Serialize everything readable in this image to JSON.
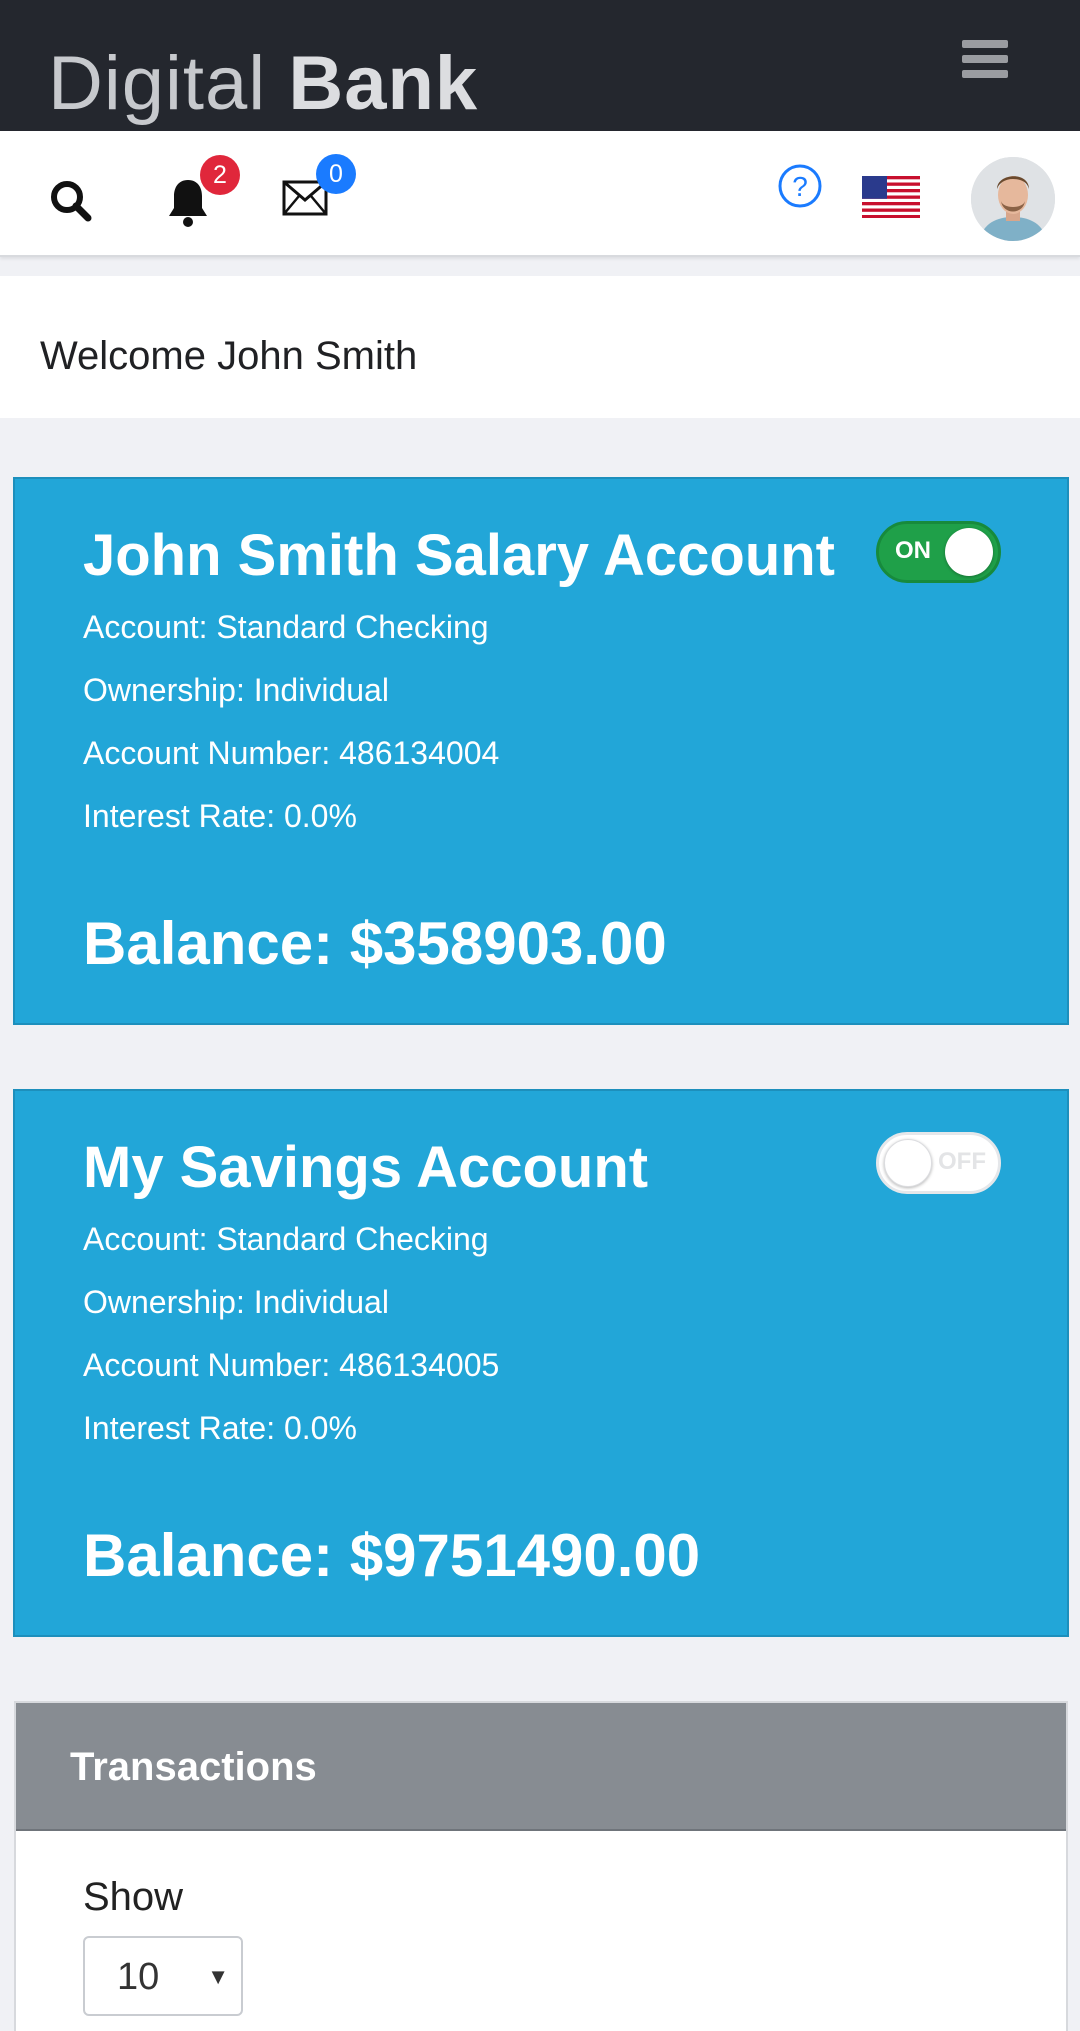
{
  "header": {
    "brand_light": "Digital",
    "brand_bold": "Bank"
  },
  "toolbar": {
    "notifications_count": "2",
    "messages_count": "0"
  },
  "welcome": {
    "text": "Welcome John Smith"
  },
  "accounts": [
    {
      "name": "John Smith Salary Account",
      "toggle_label": "ON",
      "toggle_state": "on",
      "account_type": "Account: Standard Checking",
      "ownership": "Ownership: Individual",
      "account_number": "Account Number: 486134004",
      "interest_rate": "Interest Rate: 0.0%",
      "balance": "Balance: $358903.00"
    },
    {
      "name": "My Savings Account",
      "toggle_label": "OFF",
      "toggle_state": "off",
      "account_type": "Account: Standard Checking",
      "ownership": "Ownership: Individual",
      "account_number": "Account Number: 486134005",
      "interest_rate": "Interest Rate: 0.0%",
      "balance": "Balance: $9751490.00"
    }
  ],
  "transactions": {
    "title": "Transactions",
    "show_label": "Show",
    "page_size": "10"
  },
  "colors": {
    "topbar": "#24272e",
    "card": "#22a6d8",
    "toggle_on": "#1fa049",
    "badge_red": "#e0273b",
    "badge_blue": "#1a7bff",
    "panel_header": "#878c92"
  },
  "icons": [
    "menu-icon",
    "search-icon",
    "bell-icon",
    "envelope-icon",
    "help-icon",
    "us-flag-icon",
    "avatar"
  ]
}
